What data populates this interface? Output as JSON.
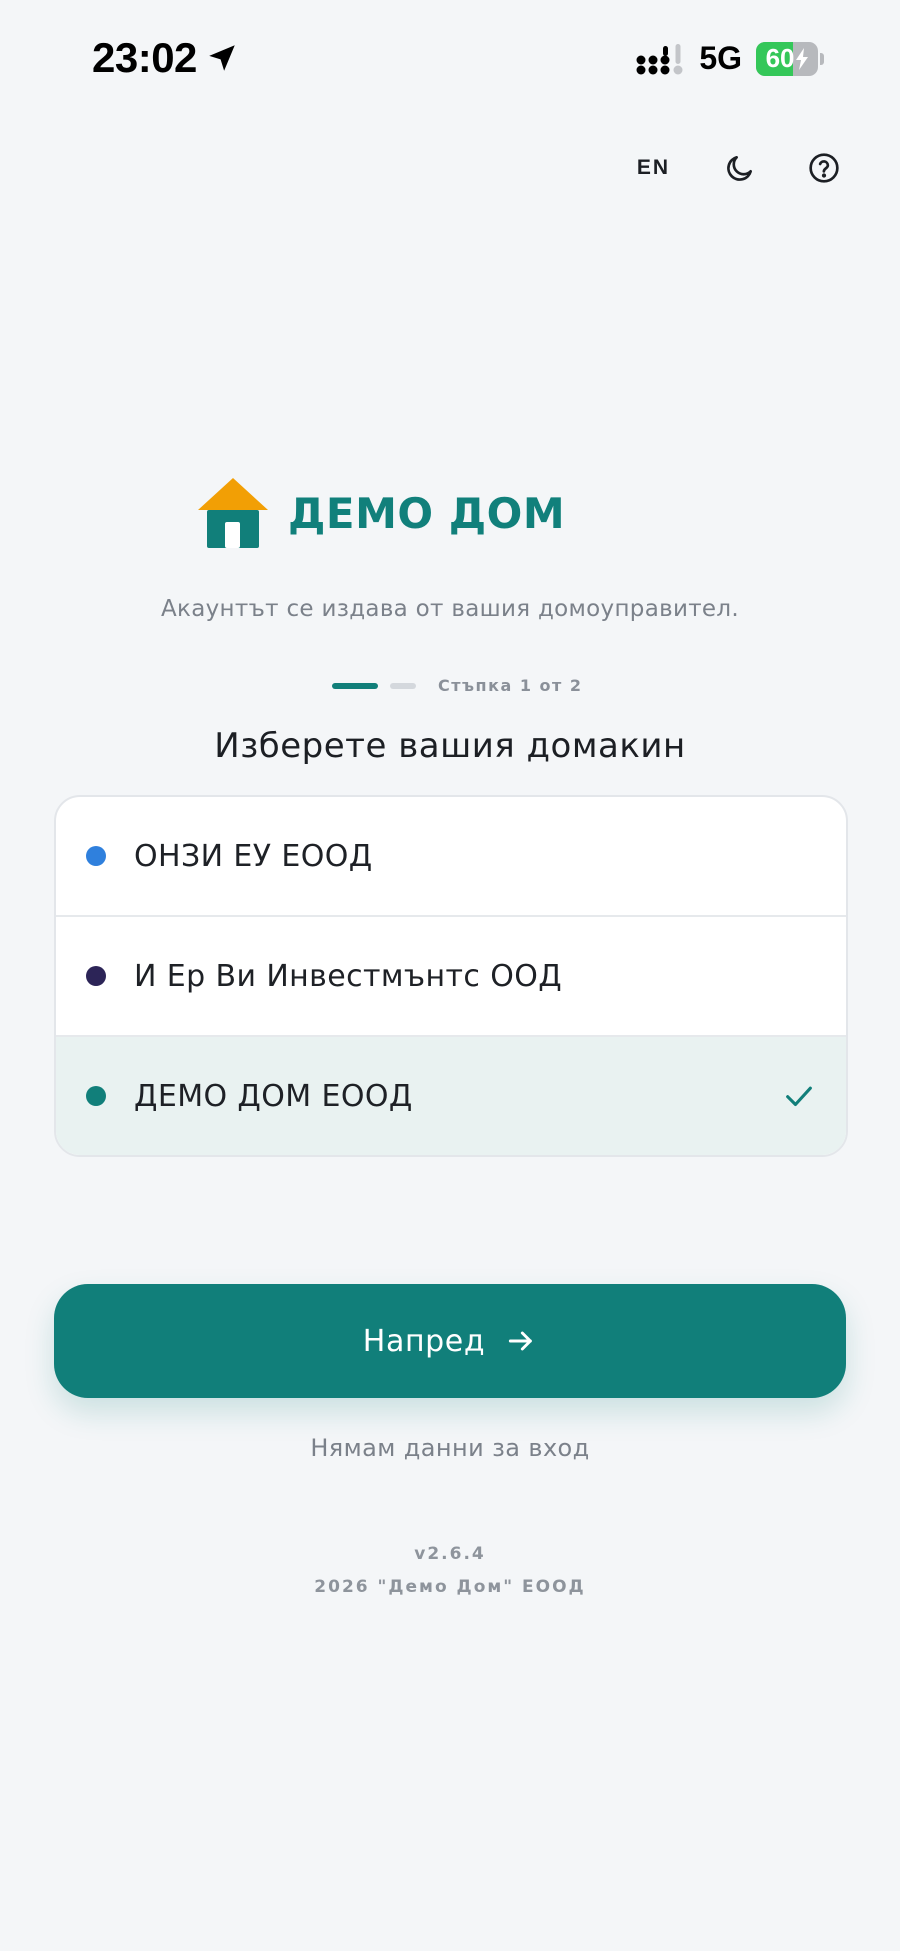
{
  "status_bar": {
    "time": "23:02",
    "network": "5G",
    "battery": "60",
    "battery_level": 0.6
  },
  "top_actions": {
    "language": "EN",
    "theme_icon": "moon-icon",
    "help_icon": "help-circle-icon"
  },
  "brand": {
    "name": "ДЕМО ДОМ",
    "logo_icon": "house-icon",
    "roof_color": "#f29f05",
    "house_color": "#117f7a"
  },
  "subtitle": "Акаунтът се издава от вашия домоуправител.",
  "stepper": {
    "label": "Стъпка 1 от 2",
    "current": 1,
    "total": 2
  },
  "section_title": "Изберете вашия домакин",
  "hosts": [
    {
      "name": "ОНЗИ ЕУ ЕООД",
      "dot_color": "#2f80dd",
      "selected": false
    },
    {
      "name": "И Ер Ви Инвестмънтс ООД",
      "dot_color": "#2c2457",
      "selected": false
    },
    {
      "name": "ДЕМО ДОМ ЕООД",
      "dot_color": "#117f7a",
      "selected": true
    }
  ],
  "actions": {
    "next_label": "Напред",
    "no_credentials": "Нямам данни за вход"
  },
  "footer": {
    "version": "v2.6.4",
    "copyright": "2026 \"Демо Дом\" ЕООД"
  },
  "colors": {
    "accent": "#117f7a",
    "background": "#f4f6f8",
    "selected_row": "#e9f2f1"
  }
}
